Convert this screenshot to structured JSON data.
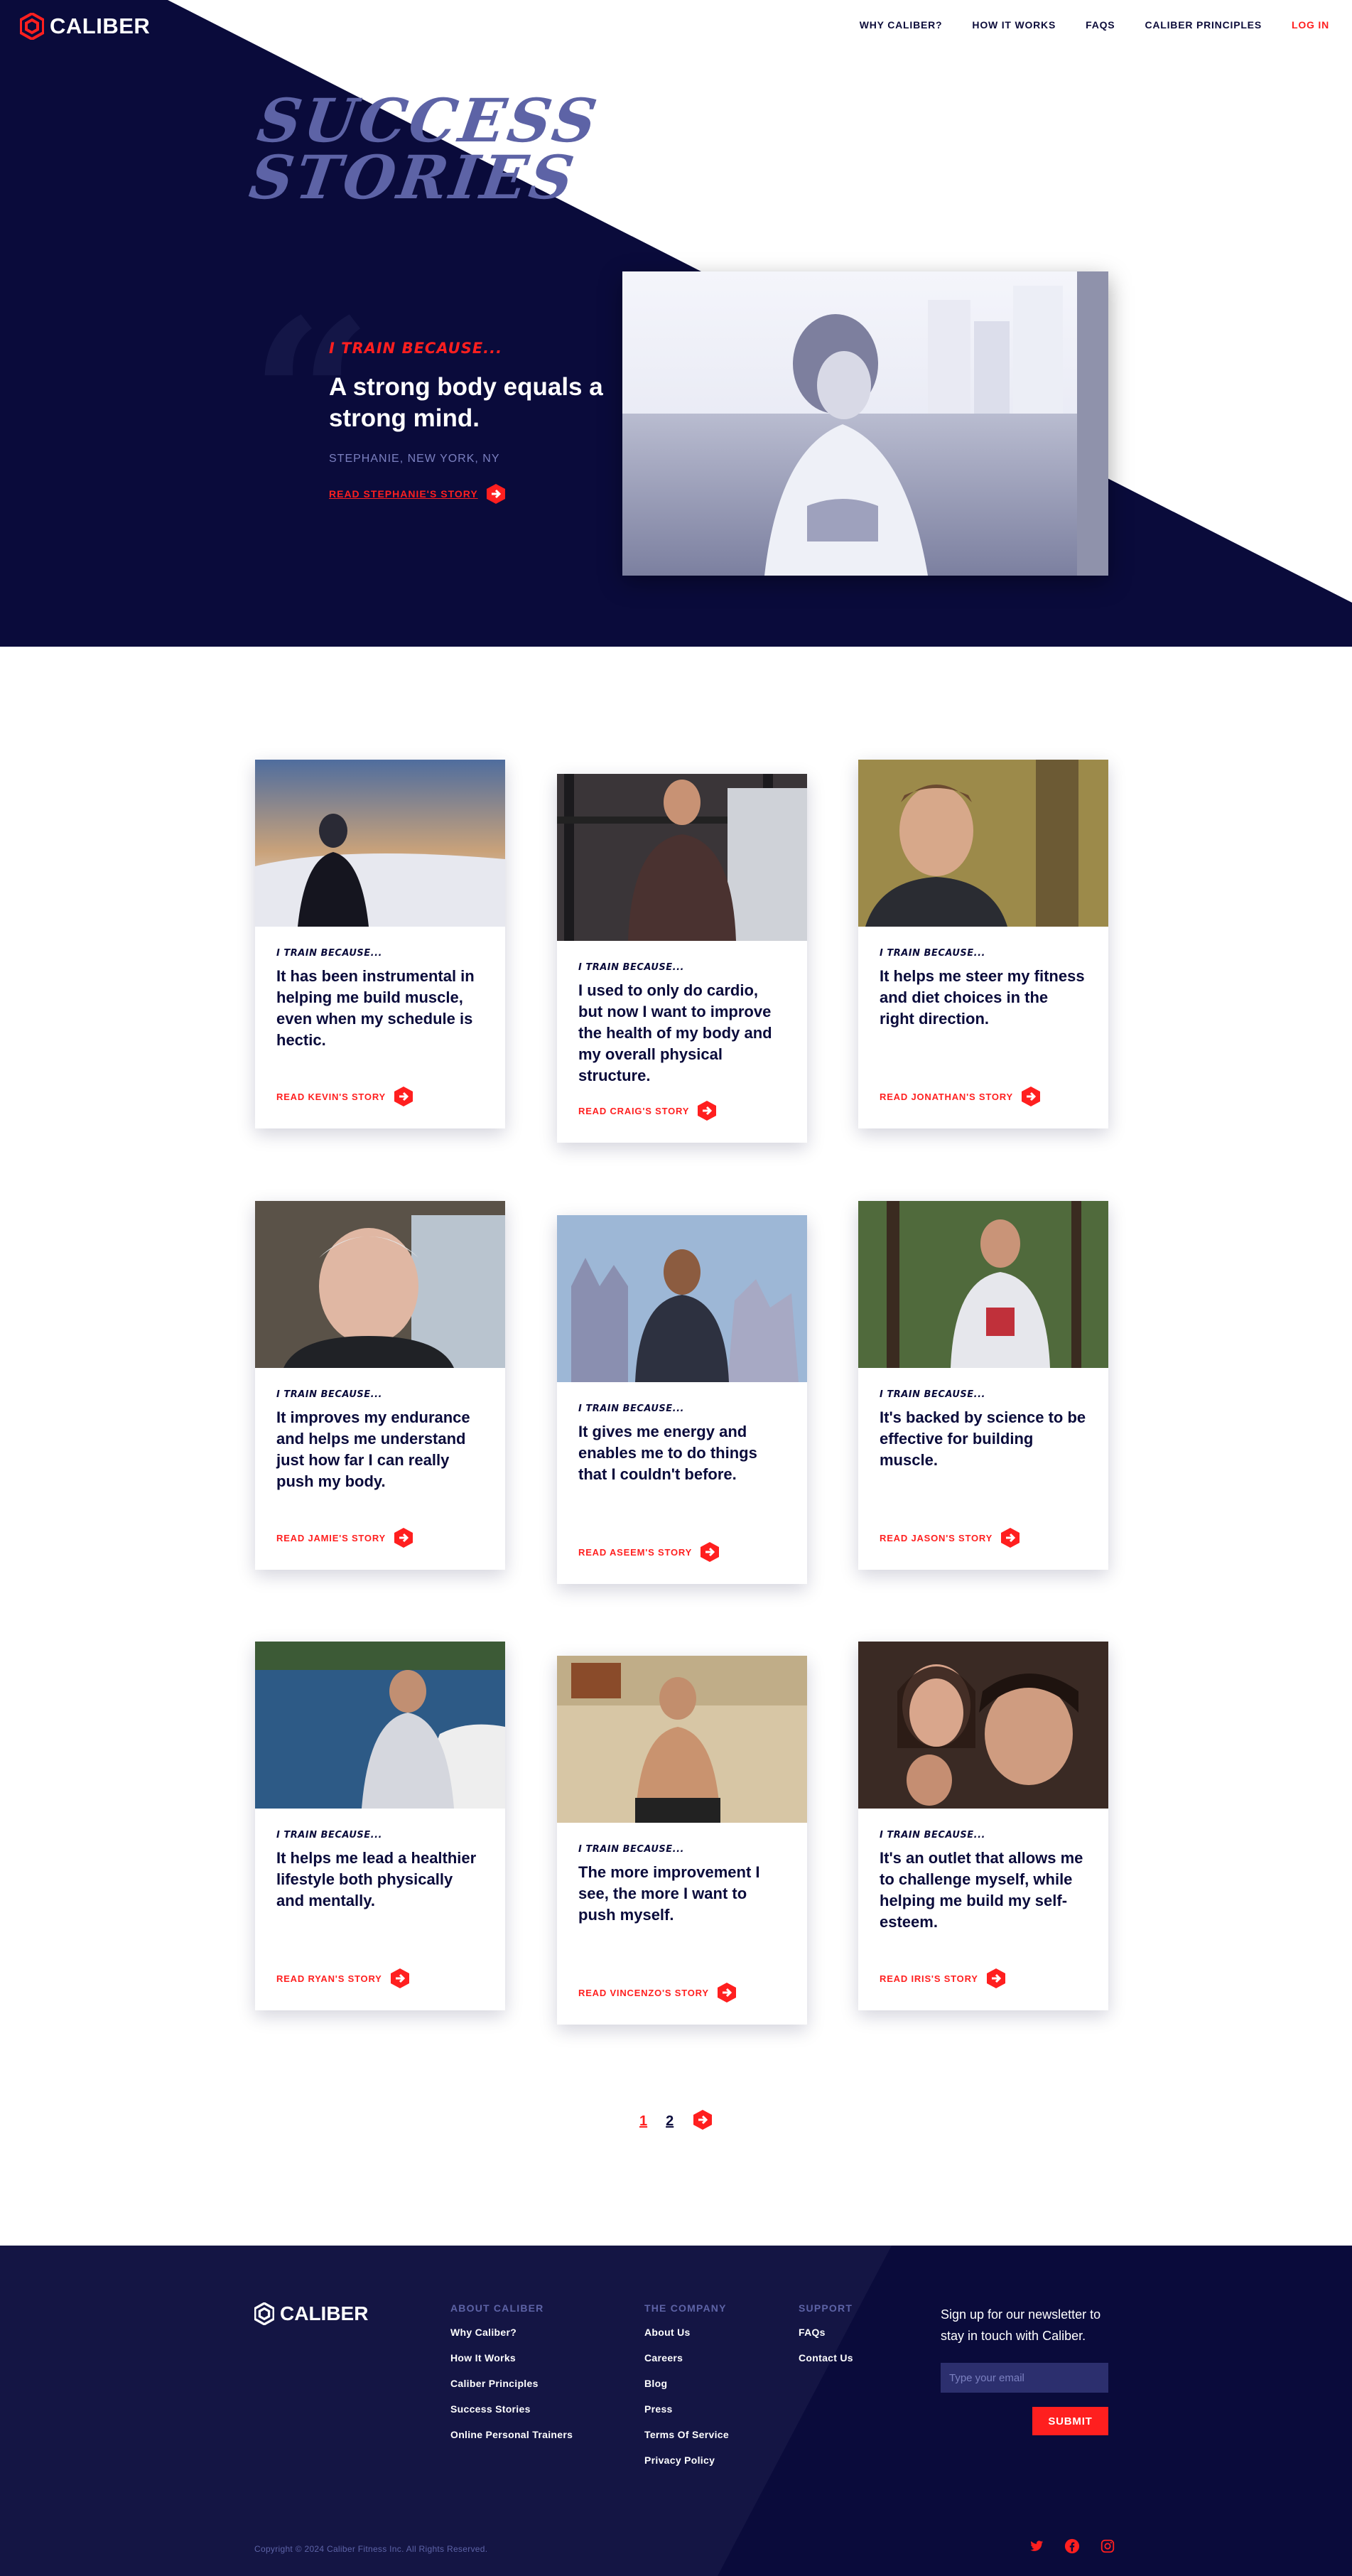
{
  "brand": {
    "name": "CALIBER",
    "accent": "#ff1f1f",
    "navy": "#0a0b3b",
    "muted": "#5d63a6"
  },
  "nav": {
    "links": [
      "WHY CALIBER?",
      "HOW IT WORKS",
      "FAQS",
      "CALIBER PRINCIPLES"
    ],
    "login": "LOG IN"
  },
  "hero": {
    "title_line1": "SUCCESS",
    "title_line2": "STORIES",
    "kicker": "I TRAIN BECAUSE...",
    "quote_line1": "A strong body equals a",
    "quote_line2": "strong mind.",
    "author": "STEPHANIE, NEW YORK, NY",
    "link": "READ STEPHANIE'S STORY"
  },
  "cards": [
    {
      "kicker": "I TRAIN BECAUSE...",
      "quote": "It has been instrumental in helping me build muscle, even when my schedule is hectic.",
      "link": "READ KEVIN'S STORY"
    },
    {
      "kicker": "I TRAIN BECAUSE...",
      "quote": "I used to only do cardio, but now I want to improve the health of my body and my overall physical structure.",
      "link": "READ CRAIG'S STORY"
    },
    {
      "kicker": "I TRAIN BECAUSE...",
      "quote": "It helps me steer my fitness and diet choices in the right direction.",
      "link": "READ JONATHAN'S STORY"
    },
    {
      "kicker": "I TRAIN BECAUSE...",
      "quote": "It improves my endurance and helps me understand just how far I can really push my body.",
      "link": "READ JAMIE'S STORY"
    },
    {
      "kicker": "I TRAIN BECAUSE...",
      "quote": "It gives me energy and enables me to do things that I couldn't before.",
      "link": "READ ASEEM'S STORY"
    },
    {
      "kicker": "I TRAIN BECAUSE...",
      "quote": "It's backed by science to be effective for building muscle.",
      "link": "READ JASON'S STORY"
    },
    {
      "kicker": "I TRAIN BECAUSE...",
      "quote": "It helps me lead a healthier lifestyle both physically and mentally.",
      "link": "READ RYAN'S STORY"
    },
    {
      "kicker": "I TRAIN BECAUSE...",
      "quote": "The more improvement I see, the more I want to push myself.",
      "link": "READ VINCENZO'S STORY"
    },
    {
      "kicker": "I TRAIN BECAUSE...",
      "quote": "It's an outlet that allows me to challenge myself, while helping me build my self-esteem.",
      "link": "READ IRIS'S STORY"
    }
  ],
  "pagination": {
    "pages": [
      "1",
      "2"
    ],
    "current": "1"
  },
  "footer": {
    "logo": "CALIBER",
    "about": {
      "heading": "ABOUT CALIBER",
      "items": [
        "Why Caliber?",
        "How It Works",
        "Caliber Principles",
        "Success Stories",
        "Online Personal Trainers"
      ]
    },
    "company": {
      "heading": "THE COMPANY",
      "items": [
        "About Us",
        "Careers",
        "Blog",
        "Press",
        "Terms Of Service",
        "Privacy Policy"
      ]
    },
    "support": {
      "heading": "SUPPORT",
      "items": [
        "FAQs",
        "Contact Us"
      ]
    },
    "newsletter": "Sign up for our newsletter to stay in touch with Caliber.",
    "email_placeholder": "Type your email",
    "submit": "SUBMIT",
    "copyright": "Copyright © 2024 Caliber Fitness Inc. All Rights Reserved.",
    "socials": [
      "twitter-icon",
      "facebook-icon",
      "instagram-icon"
    ]
  }
}
